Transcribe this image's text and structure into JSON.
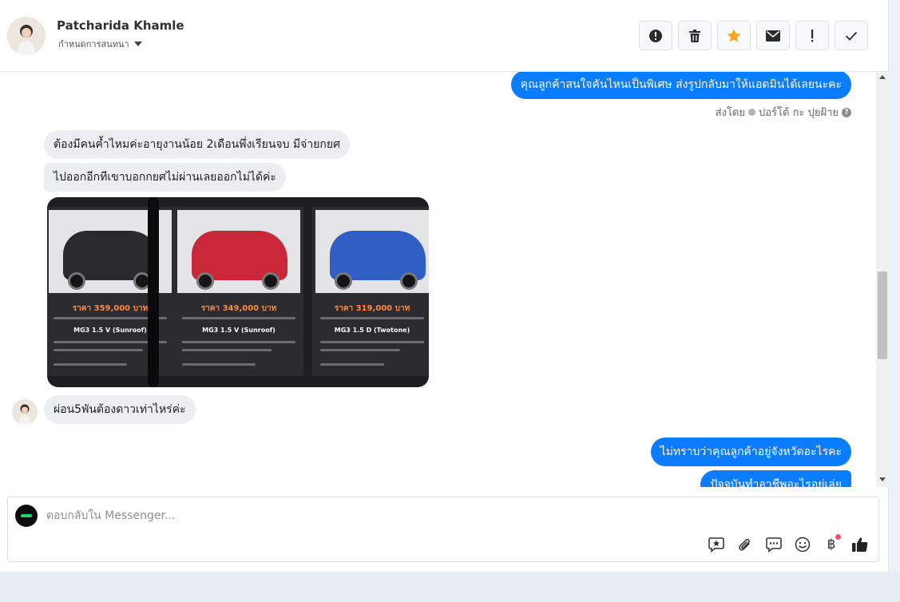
{
  "header": {
    "contact_name": "Patcharida Khamle",
    "assign_label": "กำหนดการสนทนา",
    "actions": [
      {
        "name": "report-button",
        "icon": "alert-circle-icon"
      },
      {
        "name": "delete-button",
        "icon": "trash-icon"
      },
      {
        "name": "star-button",
        "icon": "star-icon"
      },
      {
        "name": "mark-unread-button",
        "icon": "envelope-icon"
      },
      {
        "name": "important-button",
        "icon": "exclamation-icon"
      },
      {
        "name": "done-button",
        "icon": "check-icon"
      }
    ]
  },
  "messages": {
    "m1": "คุณลูกค้าสนใจคันไหนเป็นพิเศษ ส่งรูปกลับมาให้แอดมินได้เลยนะคะ",
    "sent_by": "ส่งโดย",
    "sender": "ปอร์โต้ กะ ปุยฝ้าย",
    "m2": "ต้องมีคนค้ำไหมค่ะอายุงานน้อย 2เดือนพึ่งเรียนจบ มีจ่ายกยศ",
    "m3": "ไปออกอีกทีเขาบอกกยศไม่ผ่านเลยออกไม่ได้ค่ะ",
    "m4": "ผ่อน5พันต้องดาวเท่าไหร่ค่ะ",
    "m5": "ไม่ทราบว่าคุณลูกค้าอยู่จังหวัดอะไรคะ",
    "m6": "ปัจจุบันทำอาชีพอะไรอยู่เล่ย"
  },
  "image_cards": [
    {
      "price": "ราคา 359,000 บาท",
      "model": "MG3 1.5 V (Sunroof)",
      "car_color": "#2a2a2e"
    },
    {
      "price": "ราคา 349,000 บาท",
      "model": "MG3 1.5 V (Sunroof)",
      "car_color": "#c9283a"
    },
    {
      "price": "ราคา 319,000 บาท",
      "model": "MG3 1.5 D (Twotone)",
      "car_color": "#2f5fc4"
    }
  ],
  "composer": {
    "placeholder": "ตอบกลับใน Messenger...",
    "tools": [
      "sticker-icon",
      "paperclip-icon",
      "saved-reply-icon",
      "emoji-icon",
      "baht-icon",
      "thumbs-up-icon"
    ],
    "baht_symbol": "฿"
  },
  "colors": {
    "accent": "#0a7cff",
    "star": "#f5a623",
    "incoming_bubble": "#eceef1"
  }
}
